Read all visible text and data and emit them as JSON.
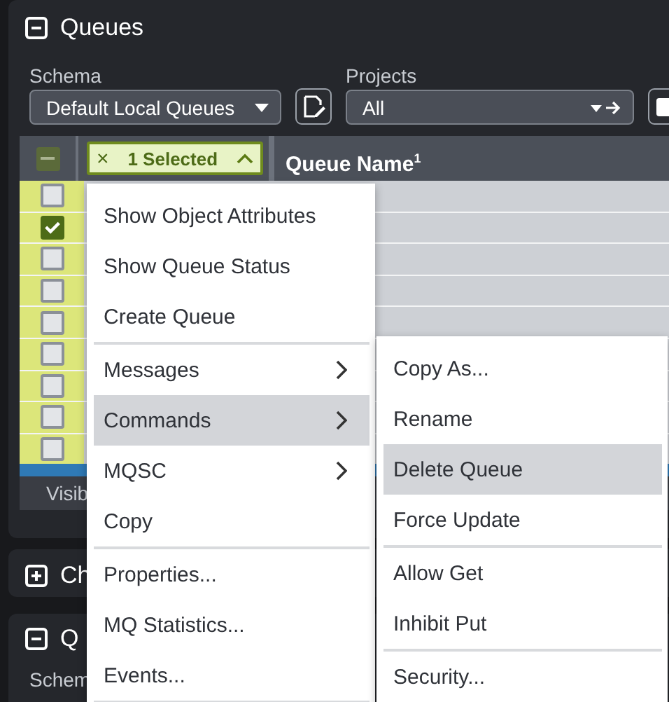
{
  "panels": [
    {
      "title": "Queues",
      "expanded": true
    },
    {
      "title": "Ch",
      "expanded": false
    },
    {
      "title": "Q",
      "expanded": true
    }
  ],
  "schema": {
    "label": "Schema",
    "value": "Default Local Queues"
  },
  "projects": {
    "label": "Projects",
    "value": "All"
  },
  "table": {
    "header_checkbox": {
      "indeterminate": true
    },
    "selection_chip": {
      "label": "1 Selected",
      "close": "×"
    },
    "columns": [
      {
        "label": "Queue Name",
        "mark": "1"
      }
    ],
    "rows": [
      {
        "checked": false
      },
      {
        "checked": true
      },
      {
        "checked": false
      },
      {
        "checked": false
      },
      {
        "checked": false
      },
      {
        "checked": false
      },
      {
        "checked": false
      },
      {
        "checked": false
      },
      {
        "checked": false
      }
    ],
    "footer": "Visib"
  },
  "panel_3_label": "Schem",
  "context_menu": [
    [
      {
        "label": "Show Object Attributes",
        "submenu": false,
        "selected": false
      },
      {
        "label": "Show Queue Status",
        "submenu": false,
        "selected": false
      },
      {
        "label": "Create Queue",
        "submenu": false,
        "selected": false
      }
    ],
    [
      {
        "label": "Messages",
        "submenu": true,
        "selected": false
      },
      {
        "label": "Commands",
        "submenu": true,
        "selected": true
      },
      {
        "label": "MQSC",
        "submenu": true,
        "selected": false
      },
      {
        "label": "Copy",
        "submenu": false,
        "selected": false
      }
    ],
    [
      {
        "label": "Properties...",
        "submenu": false,
        "selected": false
      },
      {
        "label": "MQ Statistics...",
        "submenu": false,
        "selected": false
      },
      {
        "label": "Events...",
        "submenu": false,
        "selected": false
      }
    ]
  ],
  "submenu": [
    [
      {
        "label": "Copy As...",
        "selected": false
      },
      {
        "label": "Rename",
        "selected": false
      },
      {
        "label": "Delete Queue",
        "selected": true
      },
      {
        "label": "Force Update",
        "selected": false
      }
    ],
    [
      {
        "label": "Allow Get",
        "selected": false
      },
      {
        "label": "Inhibit Put",
        "selected": false
      }
    ],
    [
      {
        "label": "Security...",
        "selected": false
      }
    ]
  ]
}
